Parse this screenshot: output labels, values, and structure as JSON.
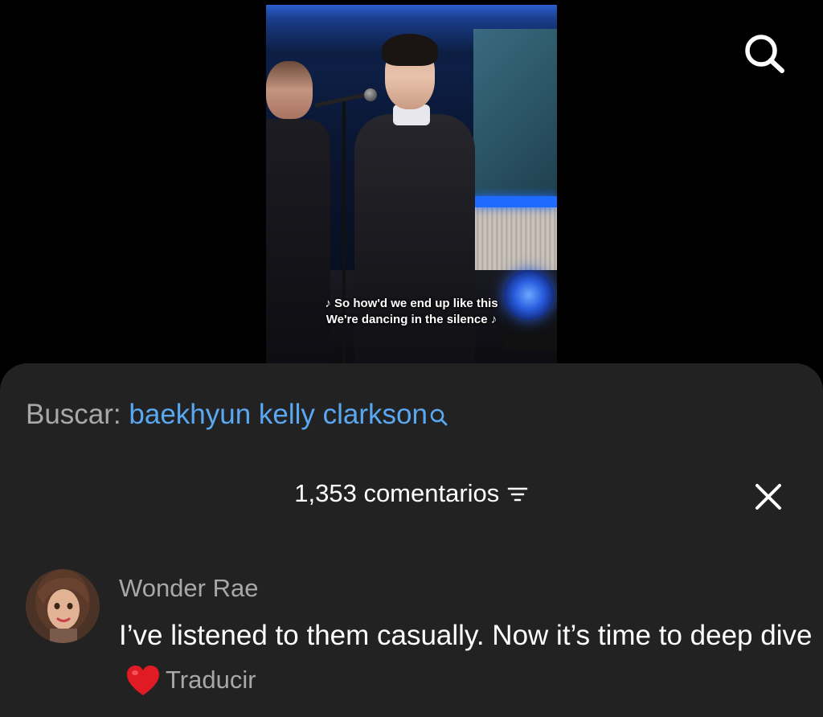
{
  "video": {
    "subtitle_line1": "♪ So how'd we end up like this",
    "subtitle_line2": "We're dancing in the silence ♪"
  },
  "top_bar": {
    "icon": "search-icon"
  },
  "sheet": {
    "search_label": "Buscar:",
    "search_query": "baekhyun kelly clarkson",
    "comment_count": "1,353 comentarios",
    "comment": {
      "username": "Wonder Rae",
      "text": "I’ve listened to them casually. Now it’s time to deep dive",
      "emoji": "heart-icon",
      "translate": "Traducir"
    }
  },
  "colors": {
    "sheet_bg": "#222222",
    "link": "#5aa7f2",
    "muted": "#a8a8a8",
    "heart": "#e01b24"
  }
}
